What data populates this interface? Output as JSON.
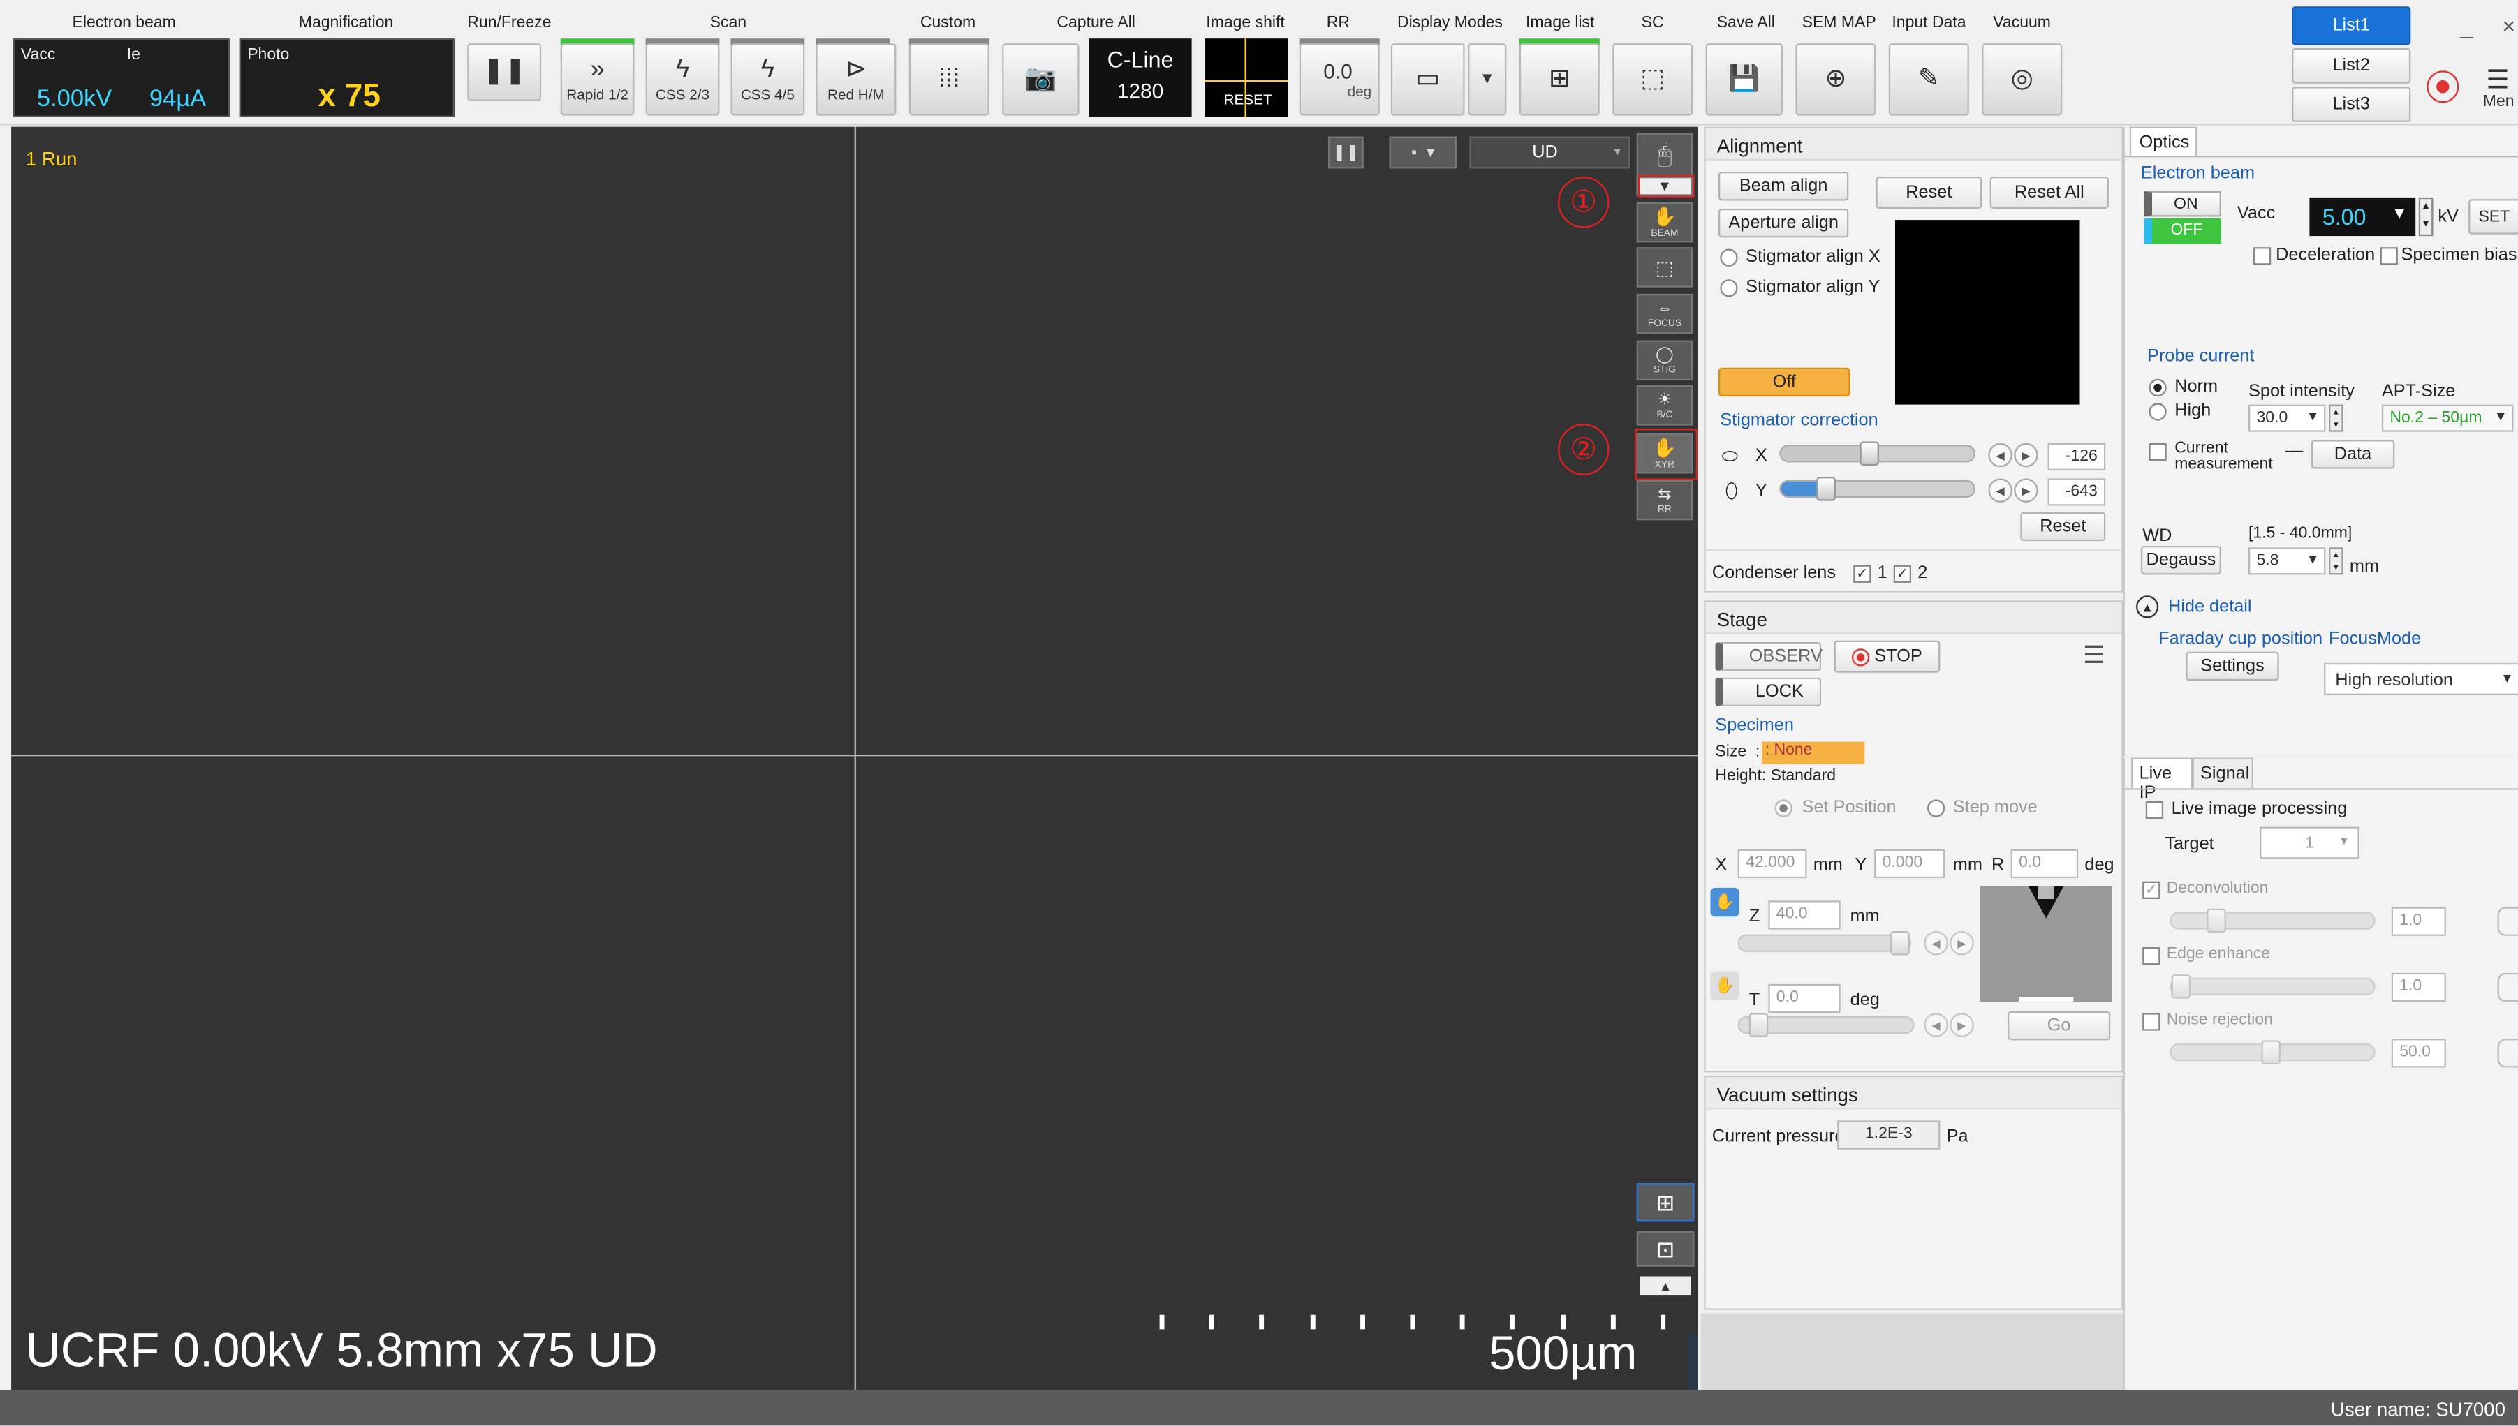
{
  "toolbar": {
    "electron_beam": {
      "group": "Electron beam",
      "vacc_label": "Vacc",
      "ie_label": "Ie",
      "vacc_value": "5.00kV",
      "ie_value": "94µA"
    },
    "magnification": {
      "group": "Magnification",
      "mode": "Photo",
      "value": "x 75"
    },
    "run_freeze": {
      "group": "Run/Freeze"
    },
    "scan": {
      "group": "Scan",
      "buttons": [
        "Rapid 1/2",
        "CSS 2/3",
        "CSS 4/5",
        "Red H/M"
      ]
    },
    "custom": {
      "group": "Custom"
    },
    "capture": {
      "group": "Capture All",
      "line_mode": "C-Line",
      "line_value": "1280"
    },
    "image_shift": {
      "group": "Image shift",
      "reset": "RESET"
    },
    "rr": {
      "group": "RR",
      "value": "0.0",
      "unit": "deg"
    },
    "display_modes": {
      "group": "Display Modes"
    },
    "image_list": {
      "group": "Image list"
    },
    "sc": {
      "group": "SC"
    },
    "save_all": {
      "group": "Save All"
    },
    "sem_map": {
      "group": "SEM MAP"
    },
    "input_data": {
      "group": "Input Data"
    },
    "vacuum": {
      "group": "Vacuum"
    },
    "lists": [
      "List1",
      "List2",
      "List3"
    ],
    "menu_label": "Men",
    "minimize": "_",
    "close": "×"
  },
  "viewer": {
    "status": "1   Run",
    "scan_dir": "UD",
    "overlay": "UCRF 0.00kV 5.8mm x75 UD",
    "scale_bar": "500µm",
    "tools": [
      "BEAM",
      "FOCUS",
      "STIG",
      "B/C",
      "XYR",
      "RR"
    ],
    "marker1": "①",
    "marker2": "②"
  },
  "alignment": {
    "title": "Alignment",
    "beam_align": "Beam align",
    "reset": "Reset",
    "reset_all": "Reset All",
    "aperture_align": "Aperture align",
    "stig_x": "Stigmator align X",
    "stig_y": "Stigmator align Y",
    "off": "Off",
    "stig_correction": "Stigmator correction",
    "x_label": "X",
    "y_label": "Y",
    "x_value": "-126",
    "y_value": "-643",
    "x_fill": 0.45,
    "y_fill": 0.2,
    "reset2": "Reset",
    "condenser": "Condenser lens",
    "cl1": "1",
    "cl2": "2"
  },
  "stage": {
    "title": "Stage",
    "observ": "OBSERV",
    "stop": "STOP",
    "lock": "LOCK",
    "specimen": "Specimen",
    "size_label": "Size",
    "size_value": "None",
    "height": "Height: Standard",
    "set_position": "Set Position",
    "step_move": "Step move",
    "x_label": "X",
    "x_value": "42.000",
    "y_label": "Y",
    "y_value": "0.000",
    "r_label": "R",
    "r_value": "0.0",
    "mm": "mm",
    "deg": "deg",
    "z_label": "Z",
    "z_value": "40.0",
    "t_label": "T",
    "t_value": "0.0",
    "go": "Go"
  },
  "vacuum_settings": {
    "title": "Vacuum settings",
    "pressure_label": "Current pressure",
    "pressure_value": "1.2E-3",
    "unit": "Pa"
  },
  "optics": {
    "tab": "Optics",
    "electron_beam": "Electron beam",
    "on": "ON",
    "off": "OFF",
    "vacc_label": "Vacc",
    "vacc_value": "5.00",
    "kv": "kV",
    "set": "SET",
    "deceleration": "Deceleration",
    "specimen_bias": "Specimen bias(+",
    "probe_current": "Probe current",
    "norm": "Norm",
    "high": "High",
    "spot_intensity": "Spot intensity",
    "spot_value": "30.0",
    "apt_size": "APT-Size",
    "apt_value": "No.2 – 50µm",
    "current_measurement1": "Current",
    "current_measurement2": "measurement",
    "dash": "—",
    "data": "Data",
    "wd": "WD",
    "wd_range": "[1.5 - 40.0mm]",
    "degauss": "Degauss",
    "wd_value": "5.8",
    "mm": "mm",
    "hide_detail": "Hide detail",
    "faraday": "Faraday cup position",
    "settings": "Settings",
    "focus_mode": "FocusMode",
    "focus_value": "High resolution"
  },
  "liveip": {
    "tab1": "Live IP",
    "tab2": "Signal",
    "live_processing": "Live image processing",
    "target": "Target",
    "target_value": "1",
    "deconvolution": "Deconvolution",
    "deconv_value": "1.0",
    "edge": "Edge enhance",
    "edge_value": "1.0",
    "noise": "Noise rejection",
    "noise_value": "50.0"
  },
  "statusbar": {
    "user": "User name: SU7000"
  }
}
